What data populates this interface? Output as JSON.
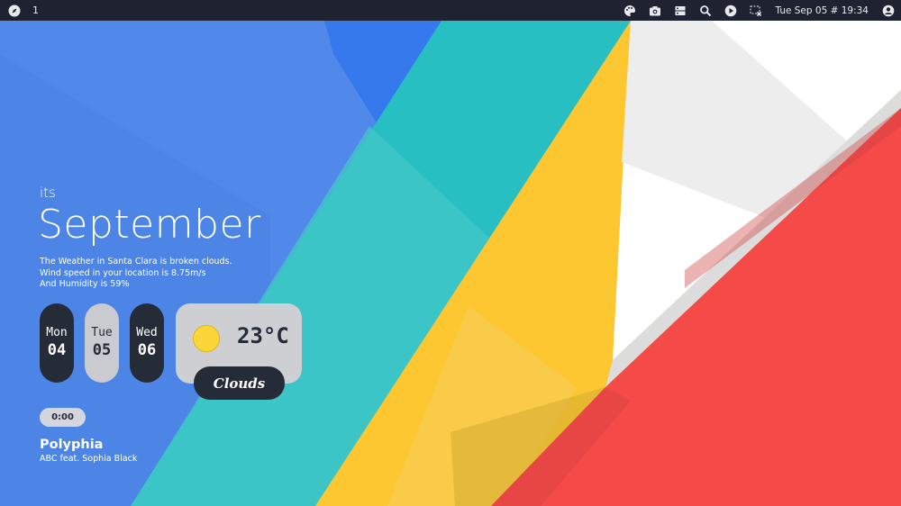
{
  "topbar": {
    "workspace": "1",
    "clock": "Tue Sep 05 # 19:34",
    "icons": [
      "compass-icon",
      "palette-icon",
      "camera-icon",
      "server-icon",
      "search-icon",
      "play-icon",
      "window-close-icon",
      "user-icon"
    ]
  },
  "widget": {
    "prefix": "its",
    "month": "September",
    "weather_lines": [
      "The Weather in Santa Clara is broken clouds.",
      "Wind speed in your location is 8.75m/s",
      "And Humidity is 59%"
    ],
    "days": [
      {
        "name": "Mon",
        "date": "04"
      },
      {
        "name": "Tue",
        "date": "05"
      },
      {
        "name": "Wed",
        "date": "06"
      }
    ],
    "temperature": "23°C",
    "condition": "Clouds",
    "sun_color": "#fbd63a"
  },
  "music": {
    "time": "0:00",
    "song": "Polyphia",
    "artist": "ABC feat. Sophia Black"
  },
  "colors": {
    "topbar": "#1f2230",
    "blue": "#4f86e8",
    "teal": "#27bcc4",
    "yellow": "#fdc731",
    "red": "#f44a48",
    "white": "#ffffff",
    "dark_pill": "#262b38",
    "light_pill": "#c9cbd0"
  }
}
